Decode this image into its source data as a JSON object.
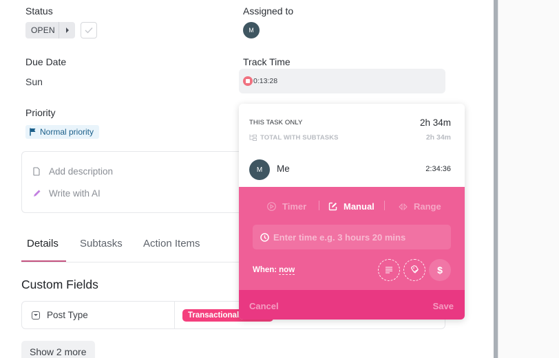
{
  "fields": {
    "status": {
      "label": "Status",
      "value": "OPEN"
    },
    "assigned": {
      "label": "Assigned to",
      "avatar_initial": "M"
    },
    "due_date": {
      "label": "Due Date",
      "value": "Sun"
    },
    "track_time": {
      "label": "Track Time",
      "running_time": "0:13:28"
    },
    "priority": {
      "label": "Priority",
      "value": "Normal priority",
      "color": "#1b5f8a"
    }
  },
  "description": {
    "add_description": "Add description",
    "write_with_ai": "Write with AI"
  },
  "tabs": [
    {
      "label": "Details",
      "active": true
    },
    {
      "label": "Subtasks",
      "active": false
    },
    {
      "label": "Action Items",
      "active": false
    }
  ],
  "custom_fields": {
    "title": "Custom Fields",
    "rows": [
      {
        "name": "Post Type",
        "value": "Transactional",
        "value_color": "#f43f7d"
      }
    ],
    "show_more": "Show 2 more"
  },
  "time_popover": {
    "this_task_label": "THIS TASK ONLY",
    "this_task_value": "2h 34m",
    "total_label": "TOTAL WITH SUBTASKS",
    "total_value": "2h 34m",
    "entries": [
      {
        "avatar_initial": "M",
        "name": "Me",
        "duration": "2:34:36"
      }
    ],
    "modes": [
      {
        "label": "Timer",
        "icon": "play-circle-icon",
        "active": false
      },
      {
        "label": "Manual",
        "icon": "edit-icon",
        "active": true
      },
      {
        "label": "Range",
        "icon": "range-icon",
        "active": false
      }
    ],
    "input_placeholder": "Enter time e.g. 3 hours 20 mins",
    "when_label": "When:",
    "when_value": "now",
    "cancel_label": "Cancel",
    "save_label": "Save",
    "billable_symbol": "$",
    "accent_color": "#ef5f97",
    "footer_color": "#e93882"
  }
}
